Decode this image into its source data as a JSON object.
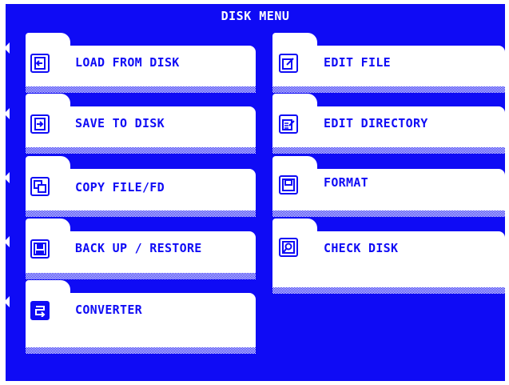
{
  "window": {
    "title": "DISK MENU"
  },
  "menu": {
    "left": [
      {
        "label": "LOAD FROM DISK",
        "icon": "load-disk-icon"
      },
      {
        "label": "SAVE TO DISK",
        "icon": "save-disk-icon"
      },
      {
        "label": "COPY FILE/FD",
        "icon": "copy-file-icon"
      },
      {
        "label": "BACK UP / RESTORE",
        "icon": "backup-restore-icon"
      },
      {
        "label": "CONVERTER",
        "icon": "converter-icon",
        "selected": true
      }
    ],
    "right": [
      {
        "label": "EDIT FILE",
        "icon": "edit-file-icon"
      },
      {
        "label": "EDIT DIRECTORY",
        "icon": "edit-directory-icon"
      },
      {
        "label": "FORMAT",
        "icon": "format-disk-icon"
      },
      {
        "label": "CHECK DISK",
        "icon": "check-disk-icon"
      }
    ]
  },
  "colors": {
    "background": "#0f0bf5",
    "panel": "#ffffff",
    "text": "#0f0bf5"
  }
}
